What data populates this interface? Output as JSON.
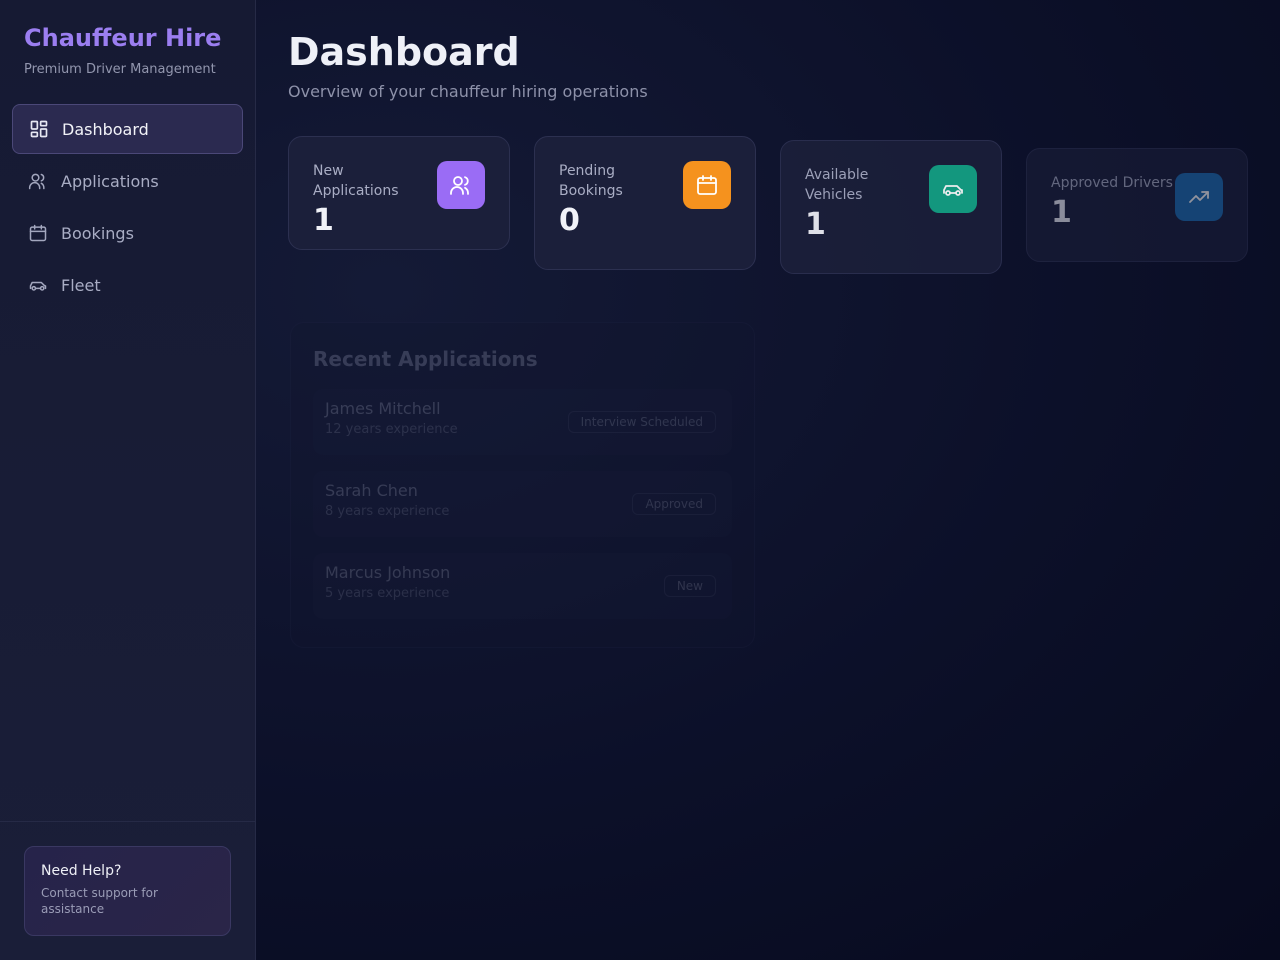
{
  "sidebar": {
    "brand_title": "Chauffeur Hire",
    "brand_subtitle": "Premium Driver Management",
    "items": [
      {
        "label": "Dashboard",
        "icon": "dashboard-icon",
        "active": true
      },
      {
        "label": "Applications",
        "icon": "users-icon",
        "active": false
      },
      {
        "label": "Bookings",
        "icon": "calendar-icon",
        "active": false
      },
      {
        "label": "Fleet",
        "icon": "car-icon",
        "active": false
      }
    ],
    "help": {
      "title": "Need Help?",
      "text": "Contact support for assistance"
    }
  },
  "header": {
    "title": "Dashboard",
    "subtitle": "Overview of your chauffeur hiring operations"
  },
  "stats": [
    {
      "label": "New Applications",
      "value": "1",
      "icon": "users-icon",
      "color": "#9a6cf5"
    },
    {
      "label": "Pending Bookings",
      "value": "0",
      "icon": "calendar-icon",
      "color": "#f5921e"
    },
    {
      "label": "Available Vehicles",
      "value": "1",
      "icon": "car-icon",
      "color": "#14a386"
    },
    {
      "label": "Approved Drivers",
      "value": "1",
      "icon": "trend-up-icon",
      "color": "#1e6fb4"
    }
  ],
  "recent": {
    "title": "Recent Applications",
    "rows": [
      {
        "name": "James Mitchell",
        "experience": "12 years experience",
        "status": "Interview Scheduled"
      },
      {
        "name": "Sarah Chen",
        "experience": "8 years experience",
        "status": "Approved"
      },
      {
        "name": "Marcus Johnson",
        "experience": "5 years experience",
        "status": "New"
      }
    ]
  }
}
